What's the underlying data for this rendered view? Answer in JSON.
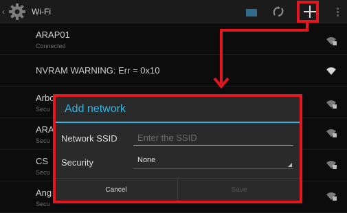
{
  "action_bar": {
    "back_glyph": "‹",
    "title": "Wi-Fi",
    "icons": [
      "settings-gear-icon",
      "wps-push-button-icon",
      "add-network-plus-icon",
      "overflow-menu-icon"
    ]
  },
  "networks": [
    {
      "name": "ARAP01",
      "status": "Connected",
      "signal": "wifi-locked-icon"
    },
    {
      "name": "NVRAM WARNING: Err = 0x10",
      "status": "",
      "signal": "wifi-open-icon"
    },
    {
      "name": "ArboC",
      "status": "Secu",
      "signal": "wifi-locked-icon"
    },
    {
      "name": "ARA",
      "status": "Secu",
      "signal": "wifi-locked-icon"
    },
    {
      "name": "CS",
      "status": "Secu",
      "signal": "wifi-locked-icon"
    },
    {
      "name": "Ang",
      "status": "Secu",
      "signal": "wifi-locked-icon"
    }
  ],
  "dialog": {
    "title": "Add network",
    "ssid_label": "Network SSID",
    "ssid_value": "",
    "ssid_placeholder": "Enter the SSID",
    "security_label": "Security",
    "security_value": "None",
    "cancel_label": "Cancel",
    "save_label": "Save"
  },
  "colors": {
    "accent": "#33b5e5",
    "annotation": "#e4161f",
    "background": "#0c0c0c"
  }
}
